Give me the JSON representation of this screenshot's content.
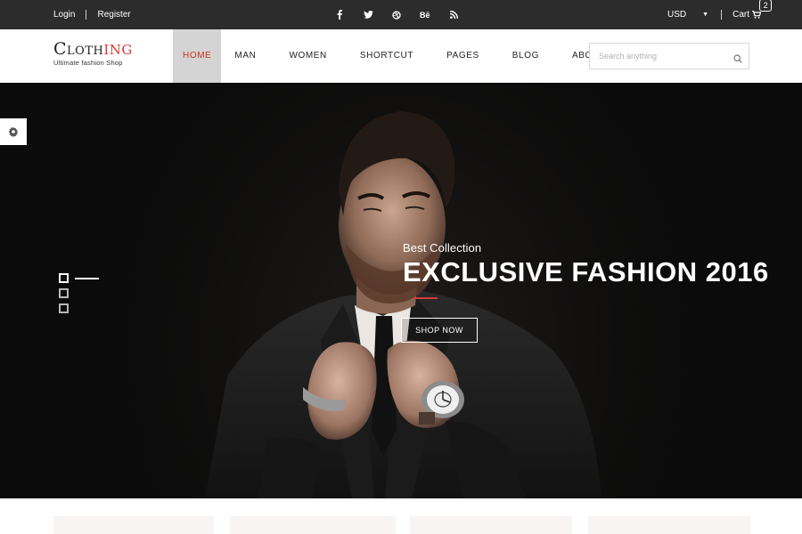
{
  "topbar": {
    "login": "Login",
    "register": "Register",
    "social": [
      "facebook-icon",
      "twitter-icon",
      "dribbble-icon",
      "behance-icon",
      "rss-icon"
    ],
    "currency": "USD",
    "currency_caret": "▼",
    "cart_label": "Cart",
    "cart_count": "2"
  },
  "header": {
    "logo": {
      "brand_start": "Cloth",
      "brand_accent": "ing",
      "tagline": "Ultimate fashion Shop"
    },
    "nav": [
      {
        "label": "HOME",
        "active": true
      },
      {
        "label": "MAN",
        "active": false
      },
      {
        "label": "WOMEN",
        "active": false
      },
      {
        "label": "SHORTCUT",
        "active": false
      },
      {
        "label": "PAGES",
        "active": false
      },
      {
        "label": "BLOG",
        "active": false
      },
      {
        "label": "ABOUT",
        "active": false
      }
    ],
    "search": {
      "placeholder": "Search anything",
      "value": ""
    }
  },
  "hero": {
    "subtitle": "Best Collection",
    "headline": "EXCLUSIVE FASHION 2016",
    "cta_label": "SHOP NOW",
    "slides": 3,
    "active_slide": 1
  },
  "colors": {
    "topbar_bg": "#2c2c2c",
    "accent": "#d63a3a",
    "nav_active_bg": "#d4d4d4",
    "nav_active_text": "#c8331f",
    "hero_bg": "#121110"
  }
}
